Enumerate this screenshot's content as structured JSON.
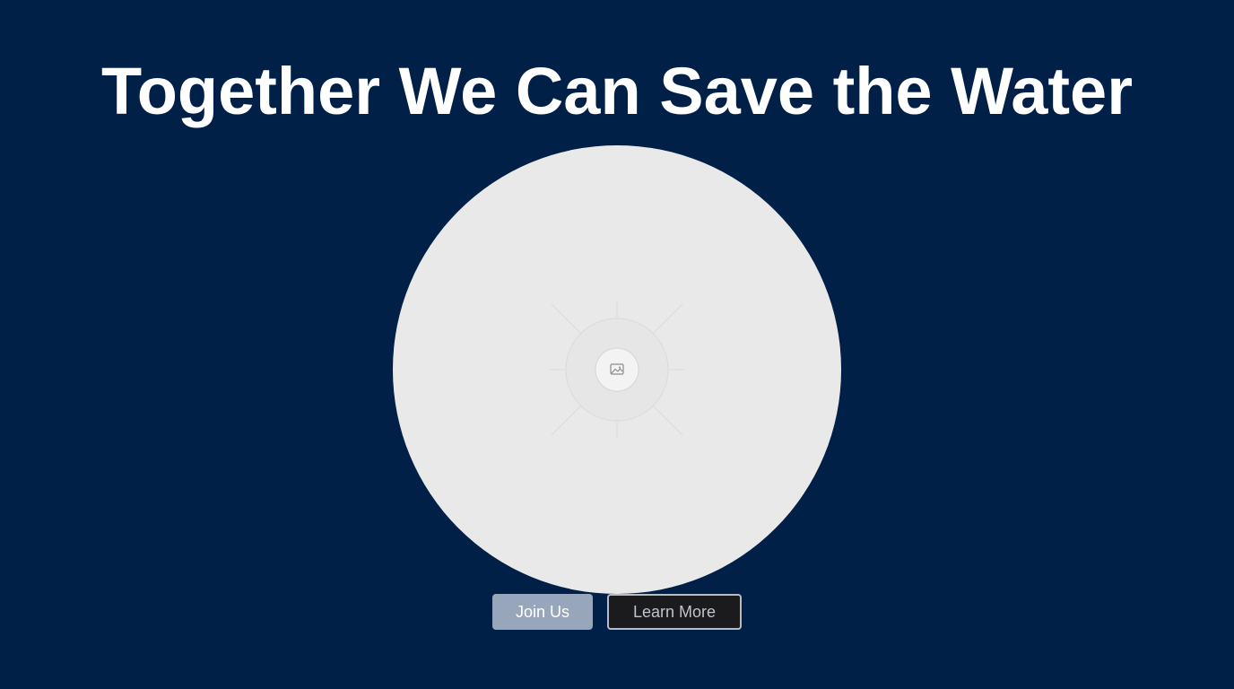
{
  "hero": {
    "title": "Together We Can Save the Water",
    "image_icon": "image-placeholder-icon"
  },
  "actions": {
    "primary_label": "Join Us",
    "secondary_label": "Learn More"
  },
  "colors": {
    "background": "#002047",
    "title": "#ffffff",
    "image_placeholder": "#e9e9e9",
    "primary_button": "#98a6bb",
    "secondary_button": "#1b1b1e"
  }
}
